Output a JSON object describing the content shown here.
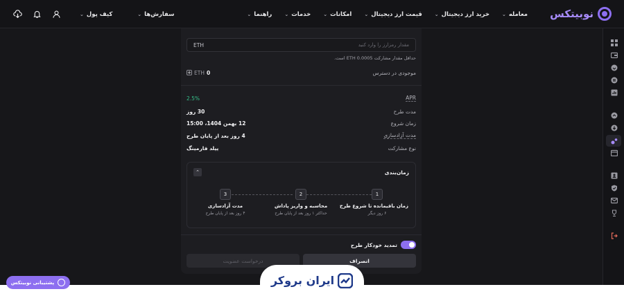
{
  "app": {
    "logo_text": "نوبیتکس",
    "nav": [
      {
        "label": "معامله"
      },
      {
        "label": "خرید ارز دیجیتال"
      },
      {
        "label": "قیمت ارز دیجیتال"
      },
      {
        "label": "امکانات"
      },
      {
        "label": "خدمات"
      },
      {
        "label": "راهنما"
      }
    ],
    "orders_label": "سفارش‌ها",
    "wallet_label": "کیف پول"
  },
  "form": {
    "amount_placeholder": "مقدار رمزارز را وارد کنید",
    "amount_unit": "ETH",
    "min_hint": "حداقل مقدار مشارکت ETH 0.0005 است.",
    "balance_label": "موجودی در دسترس",
    "balance_value": "0",
    "balance_unit": "ETH"
  },
  "details": {
    "apr_label": "APR",
    "apr_value": "2.5%",
    "duration_label": "مدت طرح",
    "duration_value": "30 روز",
    "start_label": "زمان شروع",
    "start_value": "12 بهمن 1404، 15:00",
    "release_label": "مدت آزادسازی",
    "release_value": "4 روز بعد از پایان طرح",
    "type_label": "نوع مشارکت",
    "type_value": "ییلد فارمینگ"
  },
  "schedule": {
    "title": "زمان‌بندی",
    "steps": [
      {
        "num": "1",
        "title": "زمان باقیمانده تا شروع طرح",
        "sub": "۶ روز دیگر"
      },
      {
        "num": "2",
        "title": "محاسبه و واریز پاداش",
        "sub": "حداکثر ۱ روز بعد از پایان طرح"
      },
      {
        "num": "3",
        "title": "مدت آزادسازی",
        "sub": "۴ روز بعد از پایان طرح"
      }
    ]
  },
  "auto_renew": {
    "label": "تمدید خودکار طرح",
    "enabled": true
  },
  "buttons": {
    "cancel": "انصراف",
    "submit": "درخواست عضویت"
  },
  "support_label": "پشتیبانی نوبیتکس",
  "watermark_label": "ایران بروکر",
  "colors": {
    "accent": "#8d6ff0",
    "apr_green": "#35c08a",
    "background": "#17171a"
  }
}
